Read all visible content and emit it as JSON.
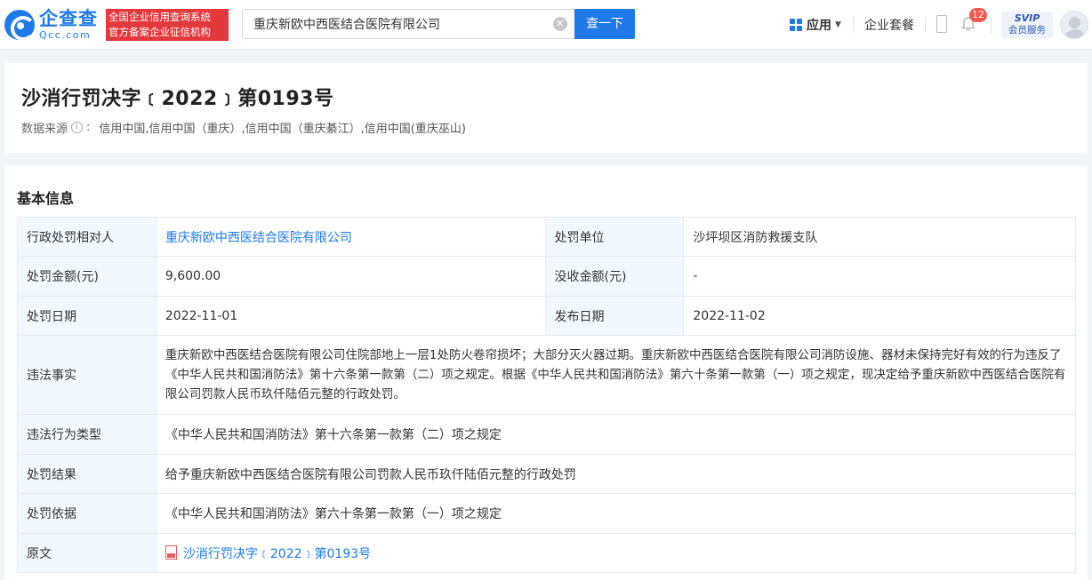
{
  "header": {
    "logo_cn": "企查查",
    "logo_en": "Qcc.com",
    "slogan_line1": "全国企业信用查询系统",
    "slogan_line2": "官方备案企业征信机构",
    "search_value": "重庆新欧中西医结合医院有限公司",
    "search_button": "查一下",
    "app_menu": "应用",
    "package_link": "企业套餐",
    "notification_count": "12",
    "svip_top": "SVIP",
    "svip_bottom": "会员服务"
  },
  "title_section": {
    "title": "沙消行罚决字﹝2022﹞第0193号",
    "source_label": "数据来源",
    "source_value": "信用中国,信用中国（重庆）,信用中国（重庆綦江）,信用中国(重庆巫山)"
  },
  "basic_info": {
    "section_title": "基本信息",
    "rows": {
      "party_label": "行政处罚相对人",
      "party_value": "重庆新欧中西医结合医院有限公司",
      "unit_label": "处罚单位",
      "unit_value": "沙坪坝区消防救援支队",
      "amount_label": "处罚金额(元)",
      "amount_value": "9,600.00",
      "confiscation_label": "没收金额(元)",
      "confiscation_value": "-",
      "date_label": "处罚日期",
      "date_value": "2022-11-01",
      "publish_label": "发布日期",
      "publish_value": "2022-11-02",
      "facts_label": "违法事实",
      "facts_value": "重庆新欧中西医结合医院有限公司住院部地上一层1处防火卷帘损坏；大部分灭火器过期。重庆新欧中西医结合医院有限公司消防设施、器材未保持完好有效的行为违反了《中华人民共和国消防法》第十六条第一款第（二）项之规定。根据《中华人民共和国消防法》第六十条第一款第（一）项之规定，现决定给予重庆新欧中西医结合医院有限公司罚款人民币玖仟陆佰元整的行政处罚。",
      "violation_type_label": "违法行为类型",
      "violation_type_value": "《中华人民共和国消防法》第十六条第一款第（二）项之规定",
      "result_label": "处罚结果",
      "result_value": "给予重庆新欧中西医结合医院有限公司罚款人民币玖仟陆佰元整的行政处罚",
      "basis_label": "处罚依据",
      "basis_value": "《中华人民共和国消防法》第六十条第一款第（一）项之规定",
      "original_label": "原文",
      "original_value": "沙消行罚决字﹝2022﹞第0193号"
    }
  },
  "colors": {
    "brand_blue": "#1f7ae8",
    "slogan_red": "#e4393c",
    "label_bg": "#f2f9fe",
    "badge_red": "#f5564f"
  }
}
